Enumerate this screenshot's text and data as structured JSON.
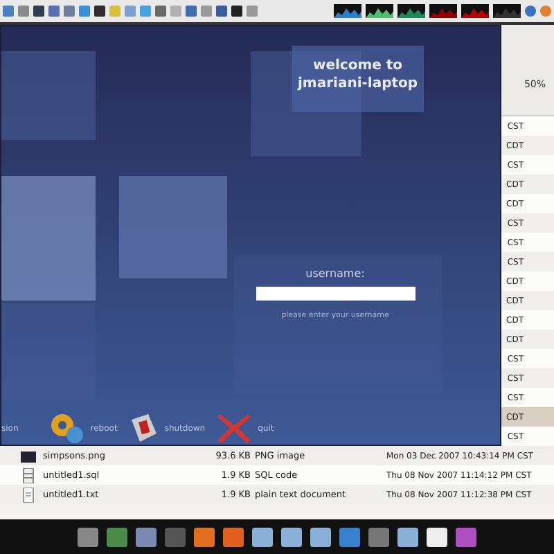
{
  "file_window": {
    "zoom": "50%",
    "rows": [
      {
        "kind": "partial",
        "selected": false,
        "date": "CST"
      },
      {
        "kind": "partial",
        "selected": false,
        "date": "CDT"
      },
      {
        "kind": "partial",
        "selected": false,
        "date": "CST"
      },
      {
        "kind": "partial",
        "selected": false,
        "date": "CDT"
      },
      {
        "kind": "partial",
        "selected": false,
        "date": "CDT"
      },
      {
        "kind": "partial",
        "selected": false,
        "date": "CST"
      },
      {
        "kind": "partial",
        "selected": false,
        "date": "CST"
      },
      {
        "kind": "partial",
        "selected": false,
        "date": "CST"
      },
      {
        "kind": "partial",
        "selected": false,
        "date": "CDT"
      },
      {
        "kind": "partial",
        "selected": false,
        "date": "CDT"
      },
      {
        "kind": "partial",
        "selected": false,
        "date": "CDT"
      },
      {
        "kind": "partial",
        "selected": false,
        "date": "CDT"
      },
      {
        "kind": "partial",
        "selected": false,
        "date": "CST"
      },
      {
        "kind": "partial",
        "selected": false,
        "date": "CST"
      },
      {
        "kind": "partial",
        "selected": false,
        "date": "CST"
      },
      {
        "kind": "partial",
        "selected": true,
        "date": "CDT"
      },
      {
        "kind": "partial",
        "selected": false,
        "date": "CST"
      },
      {
        "kind": "image",
        "selected": false,
        "name": "simpsons.png",
        "size": "93.6 KB",
        "type": "PNG image",
        "date": "Mon 03 Dec 2007 10:43:14 PM CST"
      },
      {
        "kind": "sql",
        "selected": false,
        "name": "untitled1.sql",
        "size": "1.9 KB",
        "type": "SQL code",
        "date": "Thu 08 Nov 2007 11:14:12 PM CST"
      },
      {
        "kind": "text",
        "selected": false,
        "name": "untitled1.txt",
        "size": "1.9 KB",
        "type": "plain text document",
        "date": "Thu 08 Nov 2007 11:12:38 PM CST"
      }
    ]
  },
  "login": {
    "title": [
      "welcome to",
      "jmariani-laptop"
    ],
    "label": "username:",
    "hint": "please enter your username",
    "actions": [
      {
        "kind": "session",
        "label": "sion"
      },
      {
        "kind": "reboot",
        "label": "reboot"
      },
      {
        "kind": "shutdown",
        "label": "shutdown"
      },
      {
        "kind": "quit",
        "label": "quit"
      }
    ]
  }
}
